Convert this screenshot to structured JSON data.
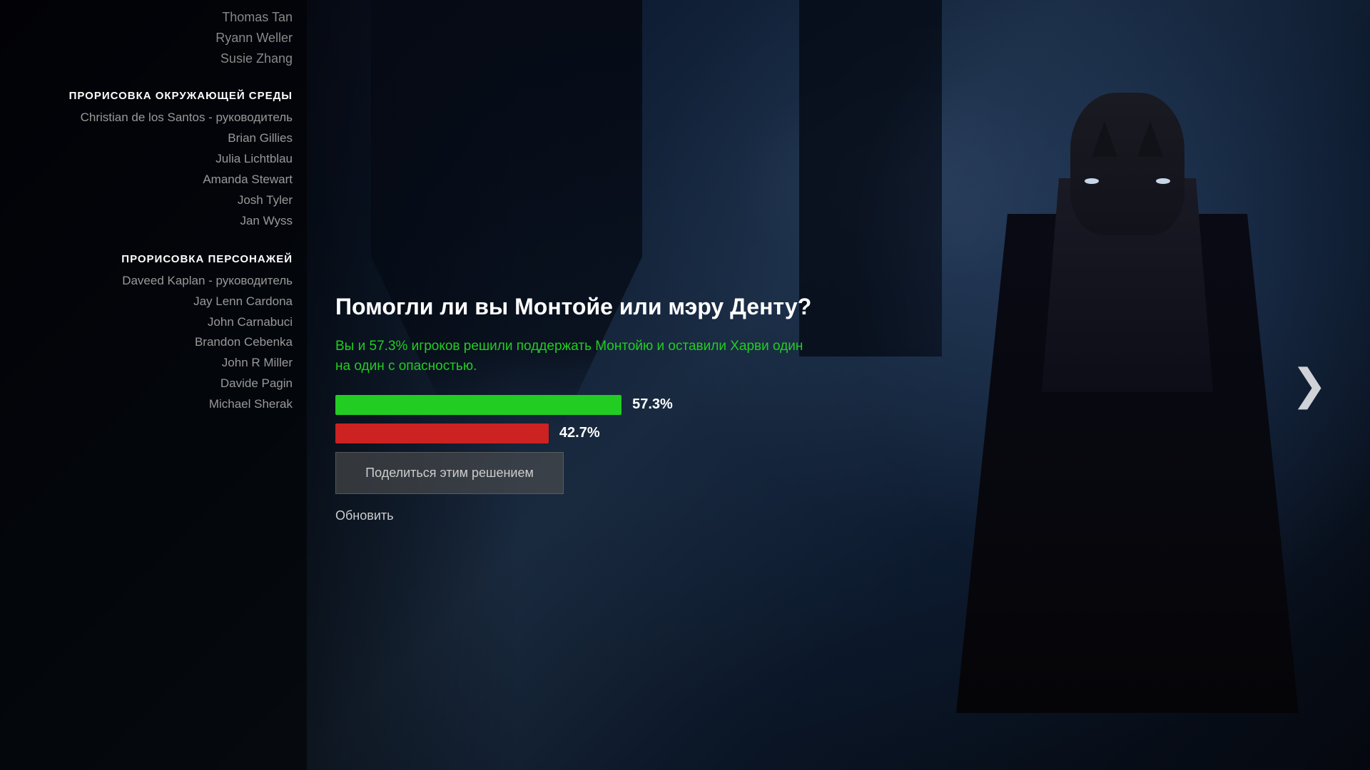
{
  "background": {
    "color": "#000000"
  },
  "credits": {
    "topNames": [
      {
        "name": "Thomas Tan",
        "id": "thomas-tan"
      },
      {
        "name": "Ryann Weller",
        "id": "ryann-weller"
      },
      {
        "name": "Susie Zhang",
        "id": "susie-zhang"
      }
    ],
    "section1": {
      "title": "ПРОРИСОВКА ОКРУЖАЮЩЕЙ СРЕДЫ",
      "members": [
        {
          "name": "Christian de los Santos - руководитель",
          "id": "christian"
        },
        {
          "name": "Brian Gillies",
          "id": "brian-gillies"
        },
        {
          "name": "Julia Lichtblau",
          "id": "julia"
        },
        {
          "name": "Amanda Stewart",
          "id": "amanda"
        },
        {
          "name": "Josh Tyler",
          "id": "josh-tyler"
        },
        {
          "name": "Jan Wyss",
          "id": "jan-wyss"
        }
      ]
    },
    "section2": {
      "title": "ПРОРИСОВКА ПЕРСОНАЖЕЙ",
      "members": [
        {
          "name": "Daveed Kaplan - руководитель",
          "id": "daveed"
        },
        {
          "name": "Jay Lenn Cardona",
          "id": "jay"
        },
        {
          "name": "John Carnabuci",
          "id": "john-c"
        },
        {
          "name": "Brandon Cebenka",
          "id": "brandon"
        },
        {
          "name": "John R Miller",
          "id": "john-m"
        },
        {
          "name": "Davide Pagin",
          "id": "davide"
        },
        {
          "name": "Michael Sherak",
          "id": "michael"
        }
      ]
    }
  },
  "poll": {
    "question": "Помогли ли вы Монтойе или мэру Денту?",
    "description": "Вы и 57.3% игроков решили поддержать Монтойю и оставили Харви один на один с опасностью.",
    "bars": [
      {
        "color": "green",
        "percent": 57.3,
        "label": "57.3%",
        "id": "bar-green"
      },
      {
        "color": "red",
        "percent": 42.7,
        "label": "42.7%",
        "id": "bar-red"
      }
    ],
    "shareButton": "Поделиться этим решением",
    "updateButton": "Обновить"
  },
  "navigation": {
    "nextArrow": "❯"
  }
}
